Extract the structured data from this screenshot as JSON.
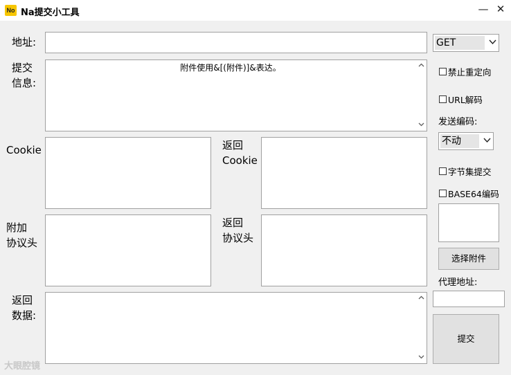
{
  "window": {
    "icon_text": "No",
    "title": "Na提交小工具",
    "minimize_glyph": "—",
    "close_glyph": "✕"
  },
  "form": {
    "address_label": "地址:",
    "address_value": "",
    "method": "GET",
    "submit_info_label": "提交\n信息:",
    "submit_info_text": "附件使用&[(附件)]&表达。",
    "cookie_label": "Cookie",
    "return_cookie_label": "返回\nCookie",
    "extra_header_label": "附加\n协议头",
    "return_header_label": "返回\n协议头",
    "return_data_label": "返回\n数据:"
  },
  "options": {
    "no_redirect": "禁止重定向",
    "url_decode": "URL解码",
    "send_encoding_label": "发送编码:",
    "send_encoding_value": "不动",
    "byte_submit": "字节集提交",
    "base64_encode": "BASE64编码",
    "choose_attachment": "选择附件",
    "proxy_label": "代理地址:",
    "proxy_value": "",
    "submit": "提交"
  },
  "watermark": "大眼腔镜"
}
